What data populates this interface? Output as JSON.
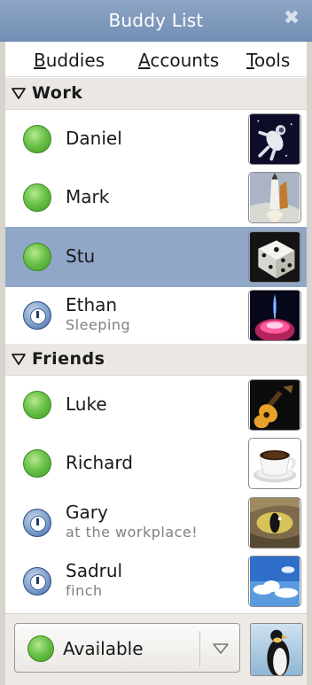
{
  "window": {
    "title": "Buddy List",
    "close_glyph": "✖"
  },
  "menu": {
    "buddies": "Buddies",
    "accounts": "Accounts",
    "tools": "Tools"
  },
  "groups": [
    {
      "name": "Work",
      "buddies": [
        {
          "name": "Daniel",
          "status": "available",
          "message": "",
          "avatar": "astronaut",
          "selected": false
        },
        {
          "name": "Mark",
          "status": "available",
          "message": "",
          "avatar": "shuttle",
          "selected": false
        },
        {
          "name": "Stu",
          "status": "available",
          "message": "",
          "avatar": "dice",
          "selected": true
        },
        {
          "name": "Ethan",
          "status": "away",
          "message": "Sleeping",
          "avatar": "plasma",
          "selected": false
        }
      ]
    },
    {
      "name": "Friends",
      "buddies": [
        {
          "name": "Luke",
          "status": "available",
          "message": "",
          "avatar": "guitar",
          "selected": false
        },
        {
          "name": "Richard",
          "status": "available",
          "message": "",
          "avatar": "coffee",
          "selected": false
        },
        {
          "name": "Gary",
          "status": "away",
          "message": "at the workplace!",
          "avatar": "cat-eye",
          "selected": false
        },
        {
          "name": "Sadrul",
          "status": "away",
          "message": "finch",
          "avatar": "sky",
          "selected": false
        }
      ]
    }
  ],
  "status_selector": {
    "label": "Available",
    "status": "available"
  },
  "colors": {
    "titlebar": "#7d98bd",
    "selected_row": "#90a7c8",
    "group_header": "#ebe8e4",
    "available": "#6cc24a",
    "away": "#5a7fb8"
  },
  "icons": {
    "close": "close-icon",
    "group_toggle": "triangle-down-icon",
    "dropdown": "chevron-down-icon"
  }
}
